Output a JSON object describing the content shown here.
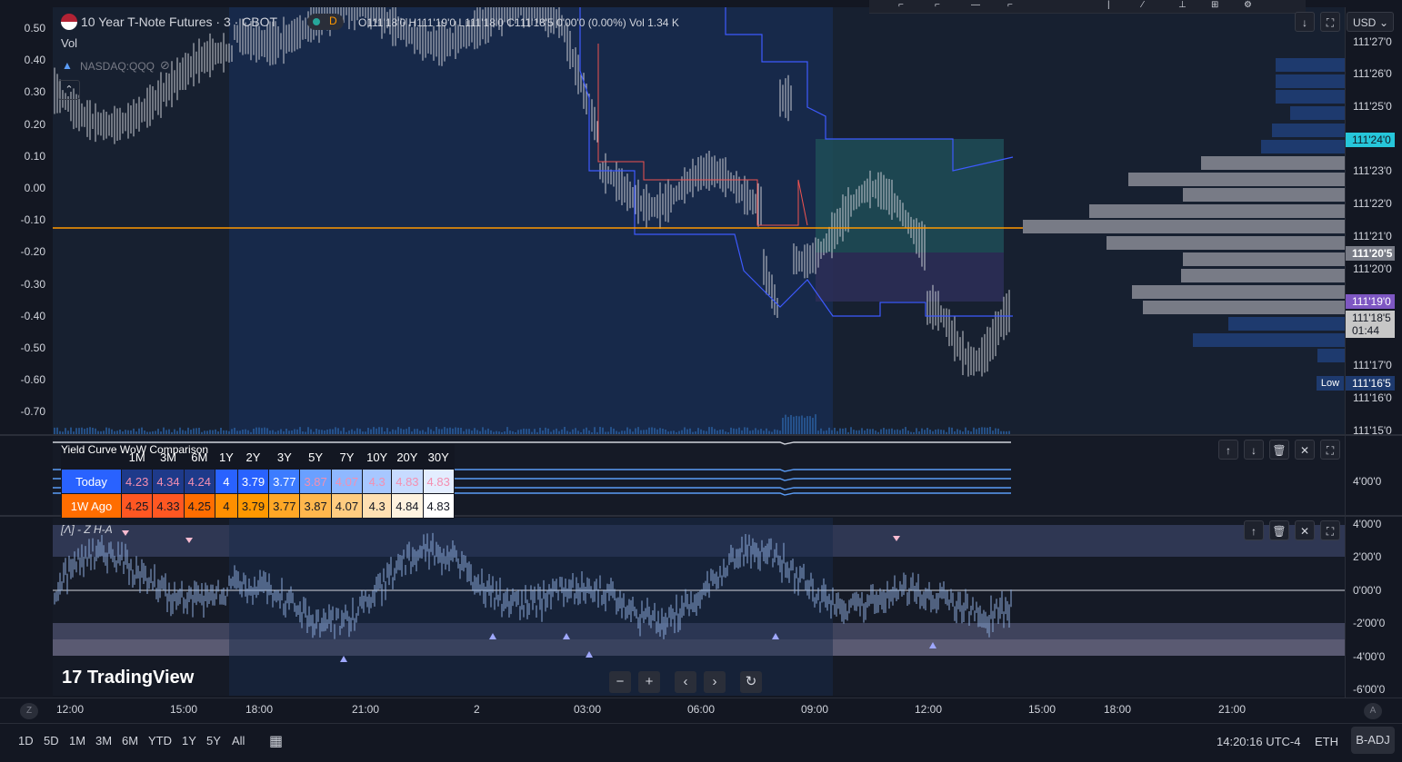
{
  "chart": {
    "title": "10 Year T-Note Futures · 3 · CBOT",
    "status_letter": "D",
    "ohlc": {
      "open": "O111'18'0",
      "high": "H111'19'0",
      "low": "L111'18'0",
      "close": "C111'18'5",
      "change": "0'00'0 (0.00%)",
      "volume": "Vol 1.34 K"
    },
    "vol_label": "Vol",
    "overlay_label": "NASDAQ:QQQ",
    "currency": "USD"
  },
  "left_axis": [
    "0.50",
    "0.40",
    "0.30",
    "0.20",
    "0.10",
    "0.00",
    "-0.10",
    "-0.20",
    "-0.30",
    "-0.40",
    "-0.50",
    "-0.60",
    "-0.70"
  ],
  "price_axis": [
    "111'27'0",
    "111'26'0",
    "111'25'0",
    "111'24'0",
    "111'23'0",
    "111'22'0",
    "111'21'0",
    "111'20'5",
    "111'20'0",
    "111'19'0",
    "111'18'5",
    "01:44",
    "111'17'0",
    "111'16'5",
    "111'16'0",
    "111'15'0"
  ],
  "price_tags": {
    "cyan": "111'24'0",
    "current": "111'20'5",
    "purple": "111'19'0",
    "last": "111'18'5",
    "countdown": "01:44",
    "low_label": "Low",
    "low": "111'16'5"
  },
  "yield_table": {
    "title": "Yield Curve WoW Comparison",
    "headers": [
      "1M",
      "3M",
      "6M",
      "1Y",
      "2Y",
      "3Y",
      "5Y",
      "7Y",
      "10Y",
      "20Y",
      "30Y"
    ],
    "rows": [
      {
        "label": "Today",
        "values": [
          "4.23",
          "4.34",
          "4.24",
          "4",
          "3.79",
          "3.77",
          "3.87",
          "4.07",
          "4.3",
          "4.83",
          "4.83"
        ]
      },
      {
        "label": "1W Ago",
        "values": [
          "4.25",
          "4.33",
          "4.25",
          "4",
          "3.79",
          "3.77",
          "3.87",
          "4.07",
          "4.3",
          "4.84",
          "4.83"
        ]
      }
    ]
  },
  "ind1_axis": [
    "4'00'0"
  ],
  "ind2": {
    "label": "[Λ] - Z H-A",
    "axis": [
      "4'00'0",
      "2'00'0",
      "0'00'0",
      "-2'00'0",
      "-4'00'0",
      "-6'00'0"
    ]
  },
  "time_axis": [
    "12:00",
    "15:00",
    "18:00",
    "21:00",
    "2",
    "03:00",
    "06:00",
    "09:00",
    "12:00",
    "15:00",
    "18:00",
    "21:00"
  ],
  "branding": "TradingView",
  "nav_buttons": {
    "zoom_out": "−",
    "zoom_in": "+",
    "scroll_left": "‹",
    "scroll_right": "›",
    "reset": "↻"
  },
  "pane_buttons": {
    "up": "↑",
    "down": "↓",
    "delete": "🗑",
    "collapse": "✕",
    "maximize": "⛶"
  },
  "bottom_bar": {
    "ranges": [
      "1D",
      "5D",
      "1M",
      "3M",
      "6M",
      "YTD",
      "1Y",
      "5Y",
      "All"
    ],
    "clock": "14:20:16 UTC-4",
    "session": "ETH",
    "adjust": "B-ADJ",
    "z_label": "Z",
    "a_label": "A"
  },
  "colors": {
    "bg": "#131722",
    "pane": "#172030",
    "orange_line": "#ff9800",
    "cyan": "#26c6da",
    "purple": "#7e57c2",
    "today_bg": "#2962ff",
    "ago_bg": "#ff6d00"
  }
}
